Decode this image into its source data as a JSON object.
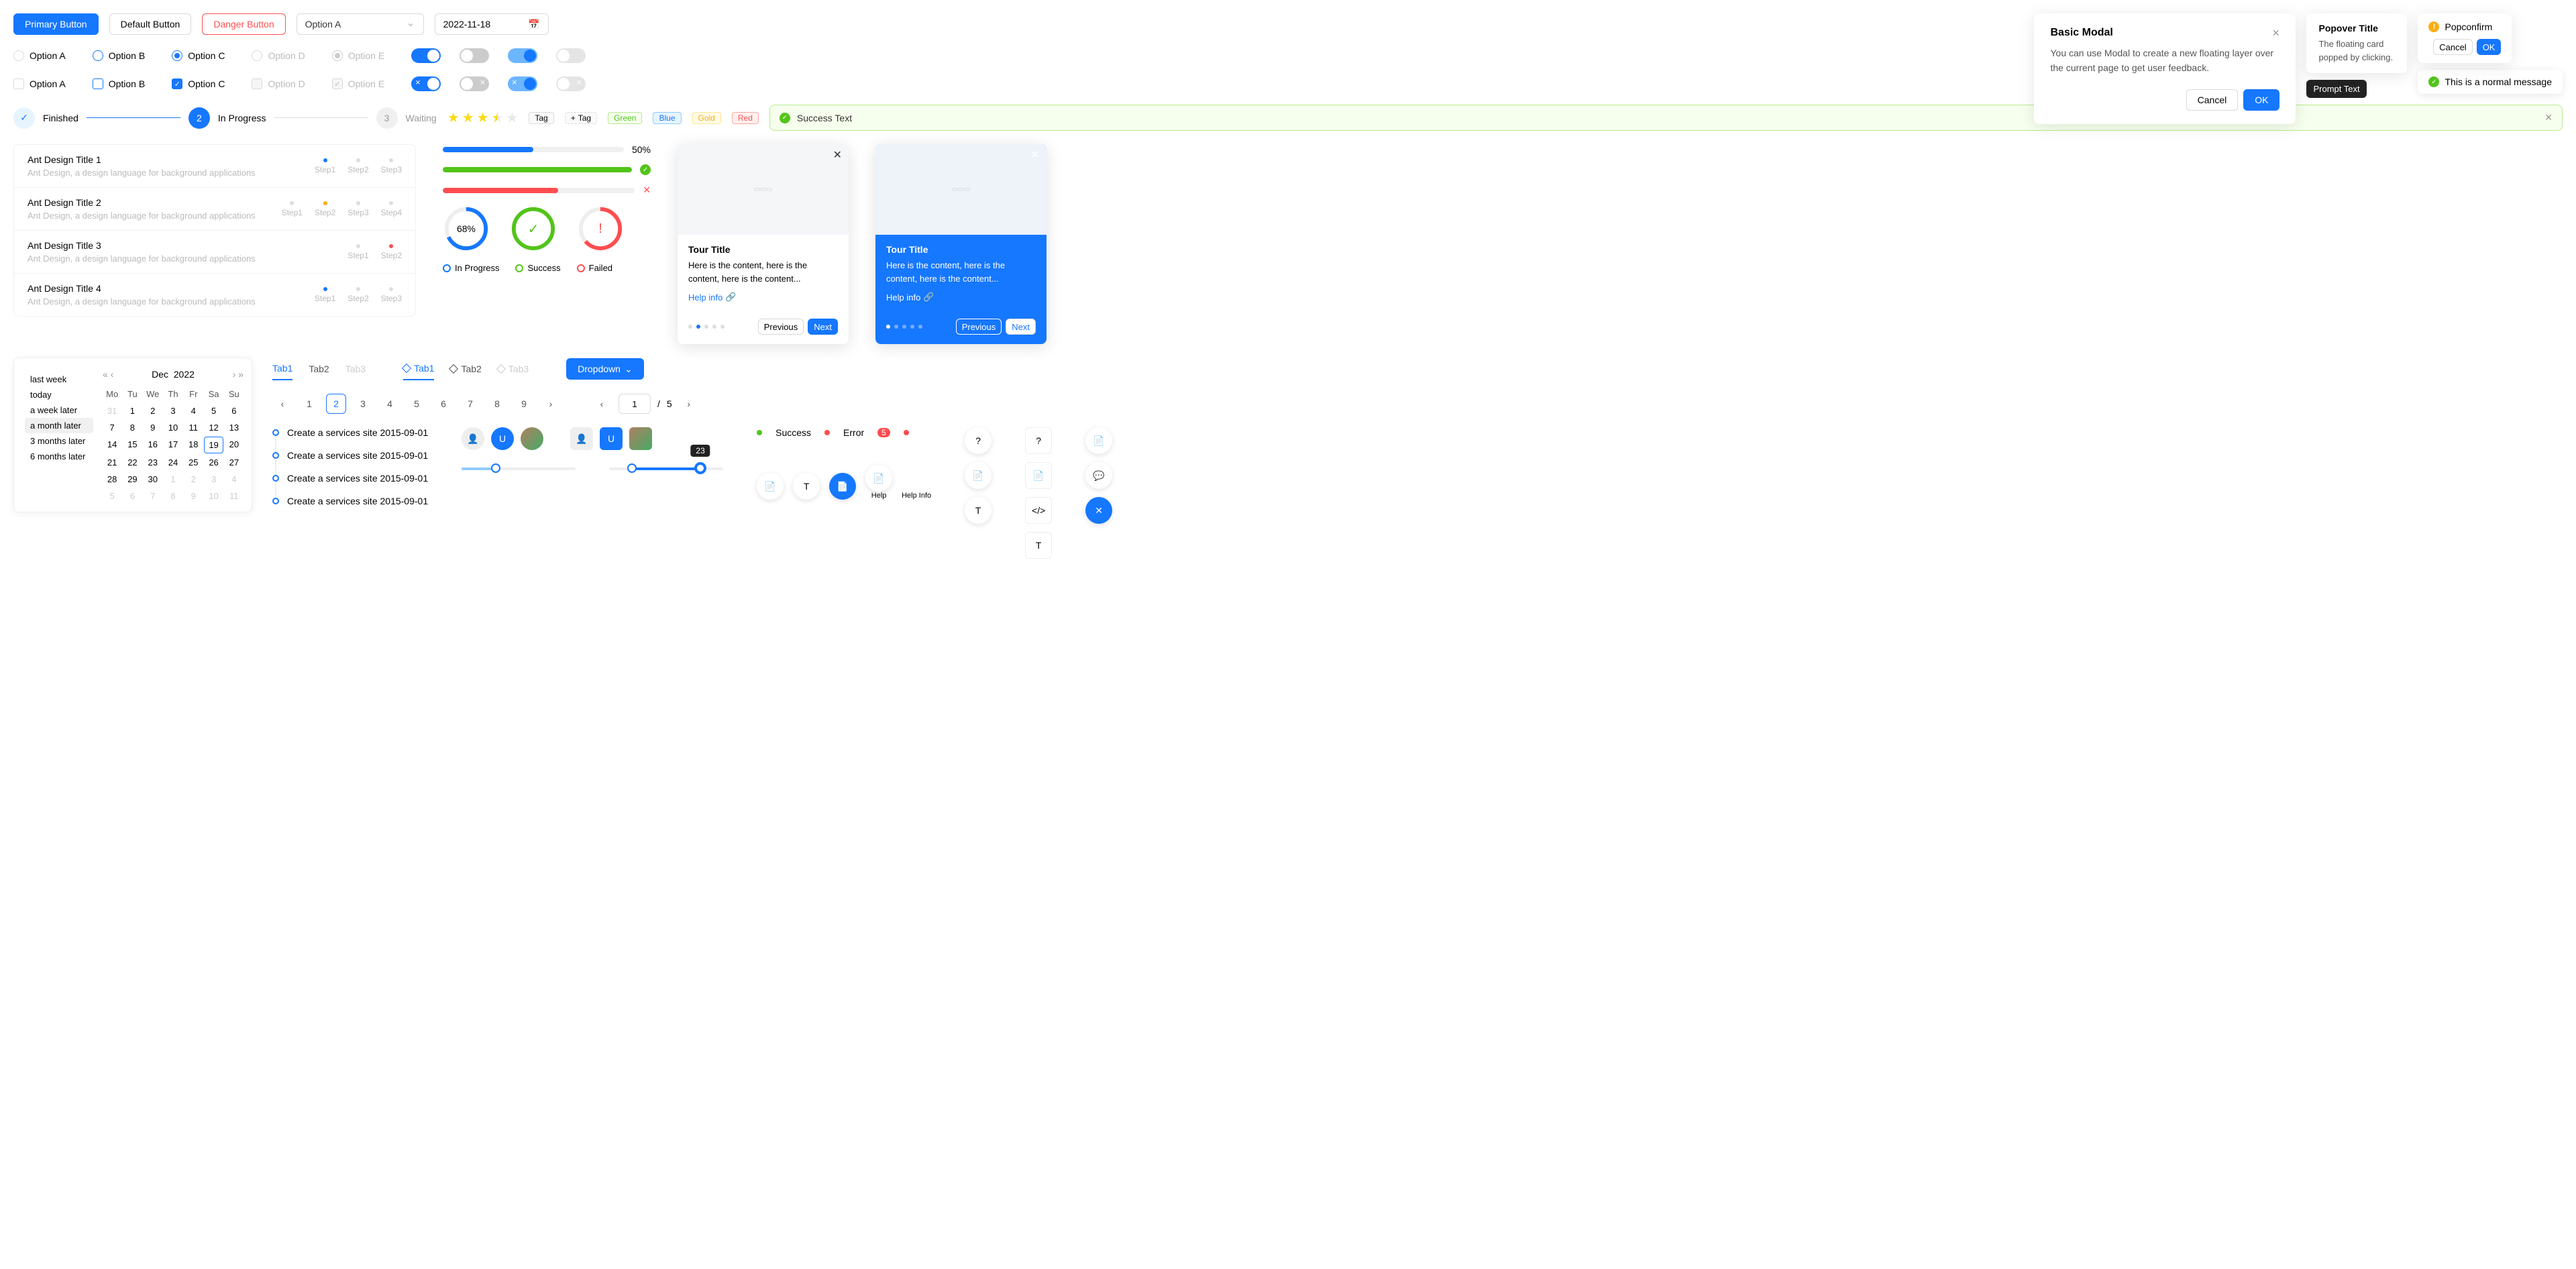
{
  "buttons": {
    "primary": "Primary Button",
    "default": "Default Button",
    "danger": "Danger Button"
  },
  "select": {
    "value": "Option A"
  },
  "date": {
    "value": "2022-11-18"
  },
  "modal": {
    "title": "Basic Modal",
    "body": "You can use Modal to create a new floating layer over the current page to get user feedback.",
    "cancel": "Cancel",
    "ok": "OK"
  },
  "popover": {
    "title": "Popover Title",
    "body": "The floating card popped by clicking."
  },
  "popconfirm": {
    "title": "Popconfirm",
    "cancel": "Cancel",
    "ok": "OK"
  },
  "tooltip": "Prompt Text",
  "message": "This is a normal message",
  "radios": {
    "a": "Option A",
    "b": "Option B",
    "c": "Option C",
    "d": "Option D",
    "e": "Option E"
  },
  "steps": {
    "1": "Finished",
    "2": "In Progress",
    "3": "Waiting",
    "n2": "2",
    "n3": "3"
  },
  "tags": {
    "plain": "Tag",
    "add": "Tag",
    "green": "Green",
    "blue": "Blue",
    "gold": "Gold",
    "red": "Red"
  },
  "alert": "Success Text",
  "list": [
    {
      "title": "Ant Design Title 1",
      "desc": "Ant Design, a design language for background applications",
      "steps": [
        "Step1",
        "Step2",
        "Step3"
      ]
    },
    {
      "title": "Ant Design Title 2",
      "desc": "Ant Design, a design language for background applications",
      "steps": [
        "Step1",
        "Step2",
        "Step3",
        "Step4"
      ]
    },
    {
      "title": "Ant Design Title 3",
      "desc": "Ant Design, a design language for background applications",
      "steps": [
        "Step1",
        "Step2"
      ]
    },
    {
      "title": "Ant Design Title 4",
      "desc": "Ant Design, a design language for background applications",
      "steps": [
        "Step1",
        "Step2",
        "Step3"
      ]
    }
  ],
  "progress": {
    "p1": "50%",
    "ring1": "68%",
    "ring2": "✓",
    "ring3": "!"
  },
  "legend": {
    "ip": "In Progress",
    "s": "Success",
    "f": "Failed"
  },
  "tour": {
    "title": "Tour Title",
    "content": "Here is the content, here is the content, here is the content...",
    "link": "Help info",
    "prev": "Previous",
    "next": "Next"
  },
  "ranges": [
    "last week",
    "today",
    "a week later",
    "a month later",
    "3 months later",
    "6 months later"
  ],
  "calendar": {
    "month": "Dec",
    "year": "2022",
    "wd": [
      "Mo",
      "Tu",
      "We",
      "Th",
      "Fr",
      "Sa",
      "Su"
    ],
    "today": "19"
  },
  "tabs": {
    "1": "Tab1",
    "2": "Tab2",
    "3": "Tab3"
  },
  "dropdown": "Dropdown",
  "pagination": {
    "total": "5",
    "sep": "/",
    "input": "1"
  },
  "timeline": "Create a services site 2015-09-01",
  "avatarU": "U",
  "slider": {
    "tip": "23"
  },
  "badges": {
    "success": "Success",
    "error": "Error",
    "count": "5"
  },
  "help": {
    "h": "Help",
    "hi": "Help Info"
  }
}
